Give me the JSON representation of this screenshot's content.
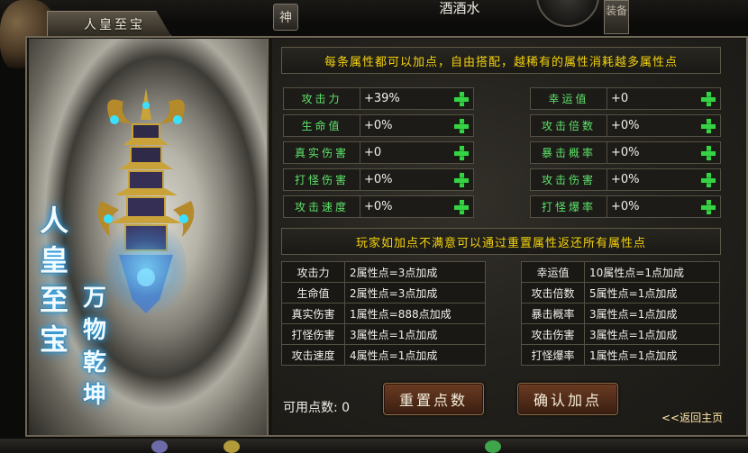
{
  "window": {
    "title": "人皇至宝",
    "player_name": "酒酒水",
    "side_tab": "神",
    "right_side_tab": "装备"
  },
  "art": {
    "callig_main": "人皇至宝",
    "callig_sub": "万物乾坤",
    "glow_color": "#33b7ff"
  },
  "tips": {
    "top": "每条属性都可以加点，自由搭配，越稀有的属性消耗越多属性点",
    "mid": "玩家如加点不满意可以通过重置属性返还所有属性点"
  },
  "attributes_left": [
    {
      "label": "攻击力",
      "value": "+39%"
    },
    {
      "label": "生命值",
      "value": "+0%"
    },
    {
      "label": "真实伤害",
      "value": "+0"
    },
    {
      "label": "打怪伤害",
      "value": "+0%"
    },
    {
      "label": "攻击速度",
      "value": "+0%"
    }
  ],
  "attributes_right": [
    {
      "label": "幸运值",
      "value": "+0"
    },
    {
      "label": "攻击倍数",
      "value": "+0%"
    },
    {
      "label": "暴击概率",
      "value": "+0%"
    },
    {
      "label": "攻击伤害",
      "value": "+0%"
    },
    {
      "label": "打怪爆率",
      "value": "+0%"
    }
  ],
  "cost_left": [
    {
      "name": "攻击力",
      "cost": "2属性点=3点加成"
    },
    {
      "name": "生命值",
      "cost": "2属性点=3点加成"
    },
    {
      "name": "真实伤害",
      "cost": "1属性点=888点加成"
    },
    {
      "name": "打怪伤害",
      "cost": "3属性点=1点加成"
    },
    {
      "name": "攻击速度",
      "cost": "4属性点=1点加成"
    }
  ],
  "cost_right": [
    {
      "name": "幸运值",
      "cost": "10属性点=1点加成"
    },
    {
      "name": "攻击倍数",
      "cost": "5属性点=1点加成"
    },
    {
      "name": "暴击概率",
      "cost": "3属性点=1点加成"
    },
    {
      "name": "攻击伤害",
      "cost": "3属性点=1点加成"
    },
    {
      "name": "打怪爆率",
      "cost": "1属性点=1点加成"
    }
  ],
  "footer": {
    "available_points": "可用点数: 0",
    "reset_label": "重置点数",
    "confirm_label": "确认加点",
    "return_label": "<<返回主页"
  },
  "colors": {
    "tip_yellow": "#f3d20d",
    "label_green": "#5de36b",
    "plus_green": "#36d445",
    "button_brown": "#6b3b22"
  }
}
